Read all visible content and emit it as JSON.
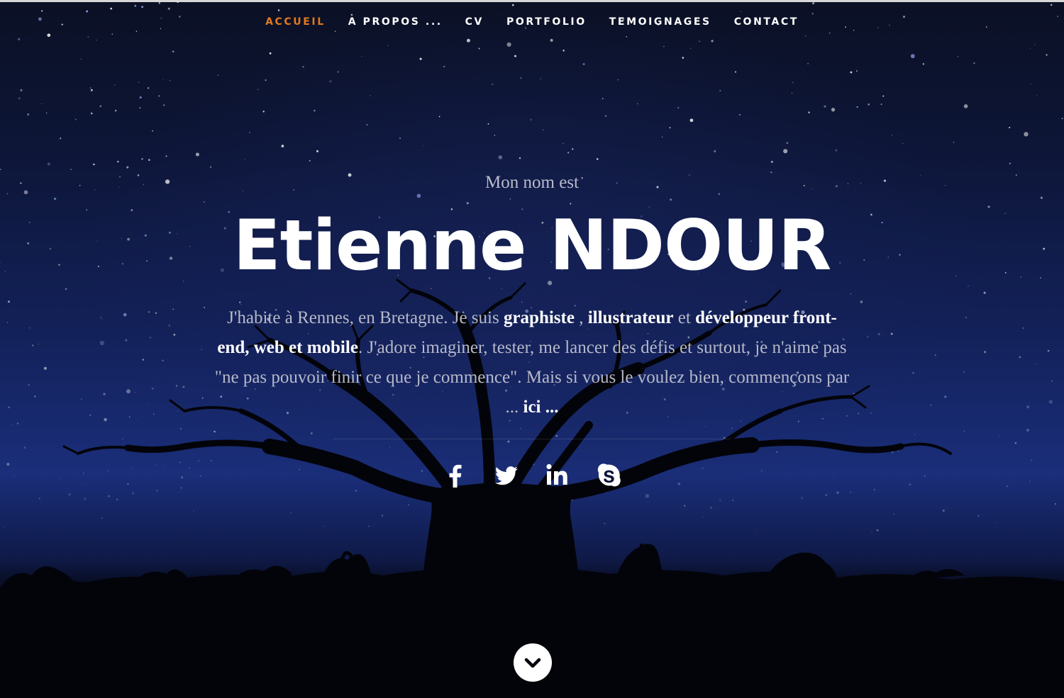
{
  "nav": {
    "items": [
      {
        "label": "ACCUEIL",
        "active": true
      },
      {
        "label": "A PROPOS ...",
        "active": false
      },
      {
        "label": "CV",
        "active": false
      },
      {
        "label": "PORTFOLIO",
        "active": false
      },
      {
        "label": "TEMOIGNAGES",
        "active": false
      },
      {
        "label": "CONTACT",
        "active": false
      }
    ]
  },
  "hero": {
    "intro": "Mon nom est",
    "name": "Etienne NDOUR",
    "bio": {
      "p1": "J'habite à Rennes, en Bretagne. Je suis ",
      "s1": "graphiste",
      "p2": " , ",
      "s2": "illustrateur",
      "p3": " et ",
      "s3": "développeur front-end, web et mobile",
      "p4": ". J'adore imaginer, tester, me lancer des défis et surtout, je n'aime pas \"ne pas pouvoir finir ce que je commence\". Mais si vous le voulez bien, commençons par ... ",
      "link": "ici ..."
    }
  },
  "social": [
    "facebook-icon",
    "twitter-icon",
    "linkedin-icon",
    "skype-icon"
  ],
  "scroll": {
    "icon": "chevron-down-icon"
  },
  "colors": {
    "accent": "#e5781f",
    "text": "#ffffff",
    "muted": "#b6b9c8"
  }
}
